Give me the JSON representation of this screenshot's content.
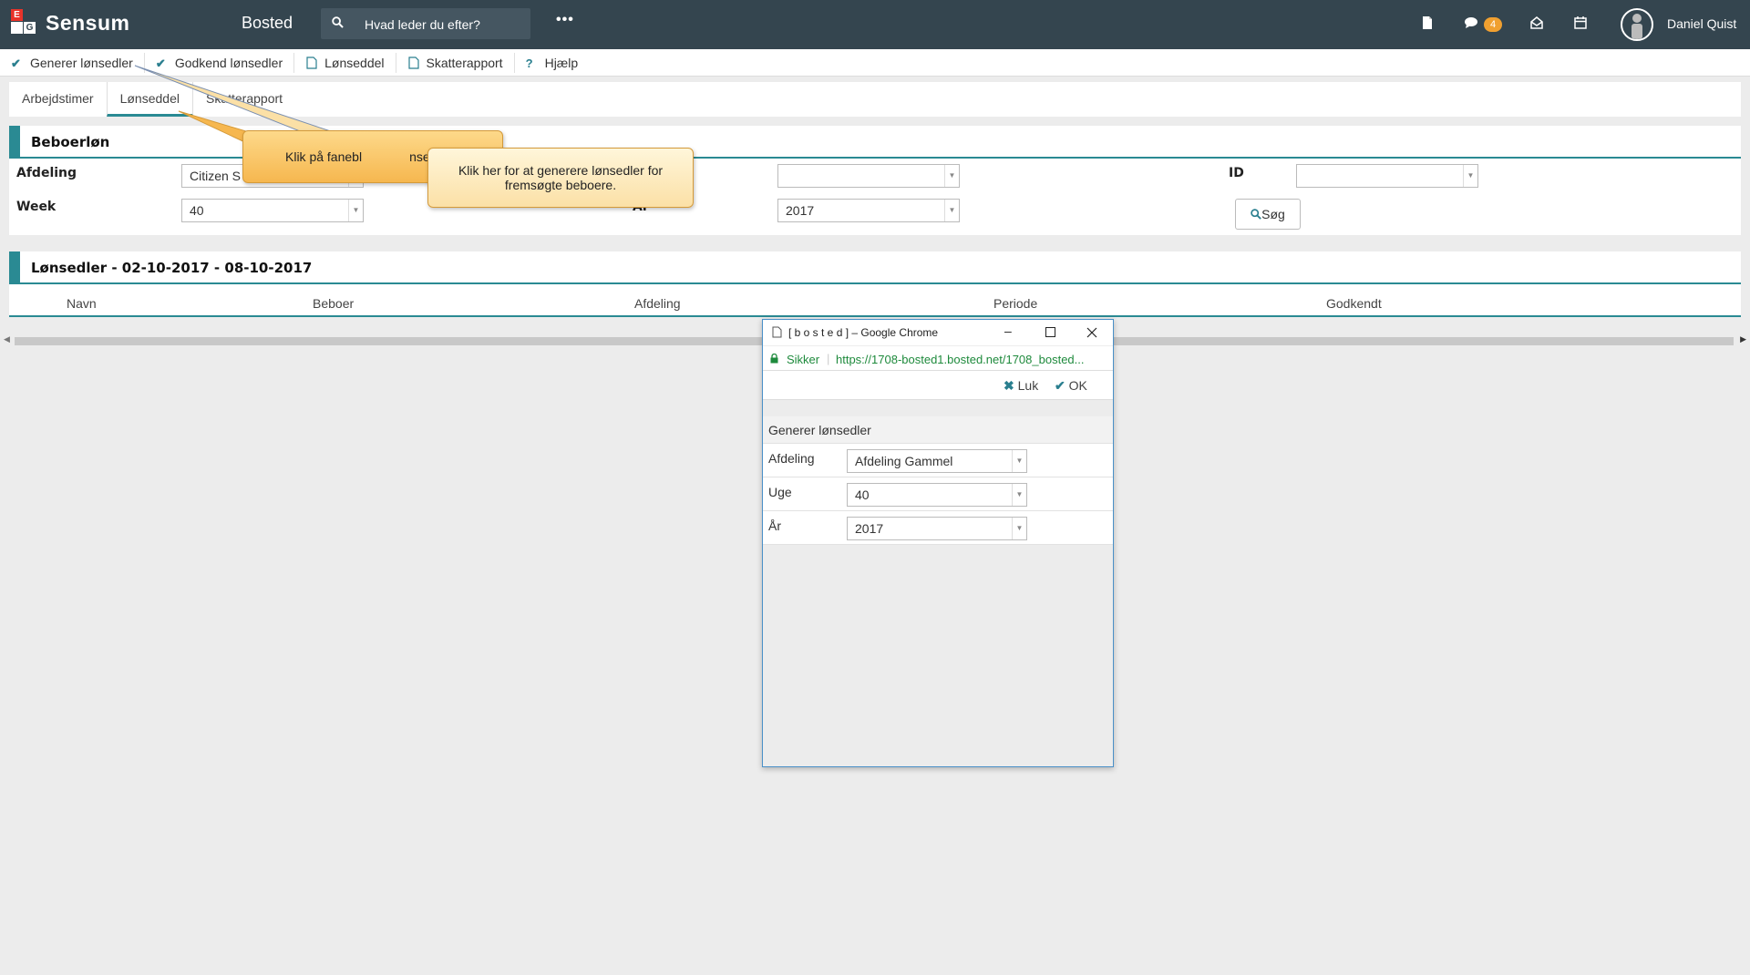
{
  "topbar": {
    "logo_letters": [
      "E",
      "G"
    ],
    "brand": "Sensum",
    "app_title": "Bosted",
    "search_placeholder": "Hvad leder du efter?",
    "notification_count": "4",
    "user_name": "Daniel Quist"
  },
  "toolbar": {
    "items": [
      {
        "label": "Generer lønsedler",
        "icon": "check-icon"
      },
      {
        "label": "Godkend lønsedler",
        "icon": "check-icon"
      },
      {
        "label": "Lønseddel",
        "icon": "pdf-icon"
      },
      {
        "label": "Skatterapport",
        "icon": "pdf-icon"
      },
      {
        "label": "Hjælp",
        "icon": "question-icon"
      }
    ]
  },
  "tabs": [
    "Arbejdstimer",
    "Lønseddel",
    "Skatterapport"
  ],
  "active_tab": "Lønseddel",
  "filter": {
    "title": "Beboerløn",
    "afdeling_label": "Afdeling",
    "afdeling_value": "Citizen S",
    "week_label": "Week",
    "week_value": "40",
    "year_label": "År",
    "year_value": "2017",
    "id_label": "ID",
    "id_value": "",
    "field2_value": "",
    "search_button": "Søg"
  },
  "results": {
    "title": "Lønsedler - 02-10-2017 - 08-10-2017",
    "columns": [
      "Navn",
      "Beboer",
      "Afdeling",
      "Periode",
      "Godkendt"
    ]
  },
  "callouts": {
    "tab_hint": "Klik på fanebl",
    "tab_hint_tail": "nse",
    "generate_hint": "Klik her for at generere lønsedler for fremsøgte beboere."
  },
  "popup": {
    "window_title": "[ b o s t e d ] – Google Chrome",
    "secure_label": "Sikker",
    "url": "https://1708-bosted1.bosted.net/1708_bosted...",
    "close_label": "Luk",
    "ok_label": "OK",
    "form_title": "Generer lønsedler",
    "fields": [
      {
        "label": "Afdeling",
        "value": "Afdeling Gammel"
      },
      {
        "label": "Uge",
        "value": "40"
      },
      {
        "label": "År",
        "value": "2017"
      }
    ]
  }
}
